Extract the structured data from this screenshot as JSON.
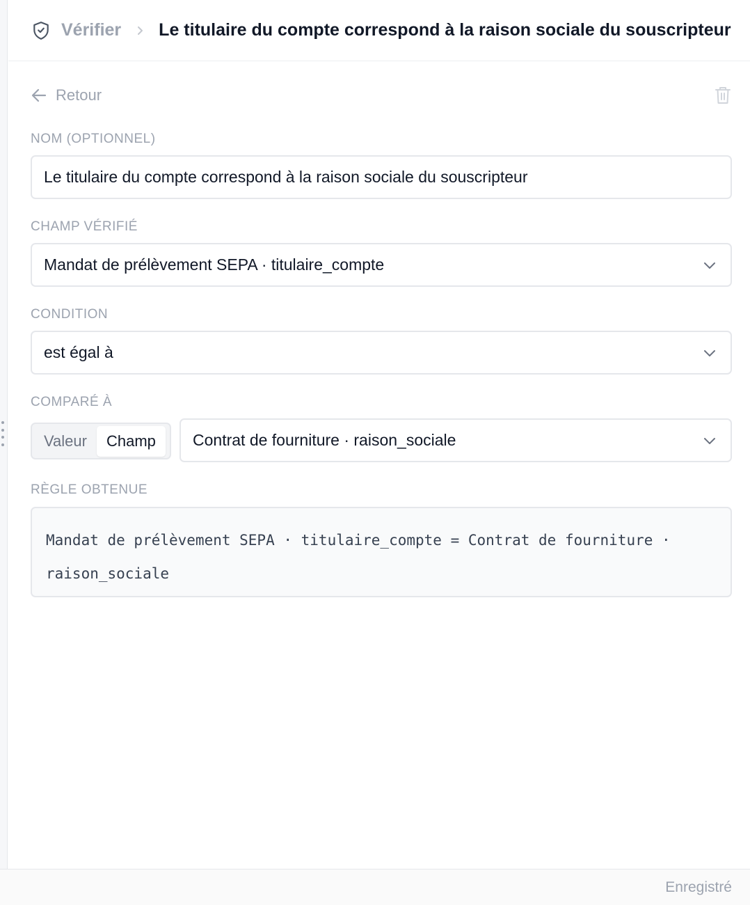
{
  "header": {
    "root_icon": "shield-check-icon",
    "root_label": "Vérifier",
    "current_label": "Le titulaire du compte correspond à la raison sociale du souscripteur"
  },
  "toolbar": {
    "back_label": "Retour",
    "delete_icon": "trash-icon"
  },
  "form": {
    "name": {
      "label": "Nom (optionnel)",
      "value": "Le titulaire du compte correspond à la raison sociale du souscripteur"
    },
    "field": {
      "label": "Champ vérifié",
      "value": "Mandat de prélèvement SEPA · titulaire_compte"
    },
    "condition": {
      "label": "Condition",
      "value": "est égal à"
    },
    "compare": {
      "label": "Comparé à",
      "modes": [
        "Valeur",
        "Champ"
      ],
      "active_mode": "Champ",
      "value": "Contrat de fourniture · raison_sociale"
    },
    "rule": {
      "label": "Règle obtenue",
      "text": "Mandat de prélèvement SEPA · titulaire_compte = Contrat de fourniture · raison_sociale"
    }
  },
  "footer": {
    "status": "Enregistré"
  },
  "colors": {
    "muted": "#9ca3af",
    "text": "#111827",
    "border": "#e5e7eb"
  }
}
